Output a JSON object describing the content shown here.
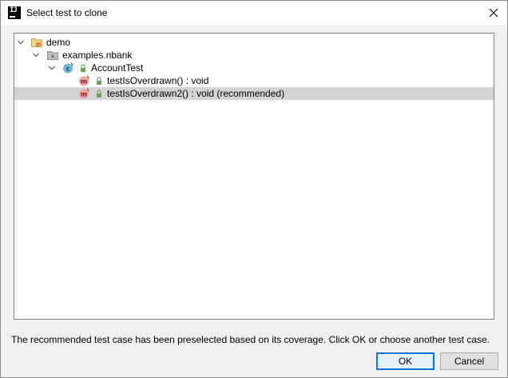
{
  "window": {
    "title": "Select test to clone",
    "app_icon_text": "IJ"
  },
  "tree": {
    "nodes": [
      {
        "label": "demo",
        "icon": "module-folder-icon",
        "expanded": true
      },
      {
        "label": "examples.nbank",
        "icon": "package-icon",
        "expanded": true
      },
      {
        "label": "AccountTest",
        "icon": "test-class-icon",
        "expanded": true
      },
      {
        "label": "testIsOverdrawn() : void",
        "icon": "test-method-icon",
        "selected": false
      },
      {
        "label": "testIsOverdrawn2() : void (recommended)",
        "icon": "test-method-icon",
        "selected": true
      }
    ]
  },
  "status_message": "The recommended test case has been preselected based on its coverage. Click OK or choose another test case.",
  "buttons": {
    "ok_label": "OK",
    "cancel_label": "Cancel"
  },
  "colors": {
    "selection": "#d4d4d4",
    "accent": "#0078d7",
    "method_badge": "#f28c8c",
    "class_badge": "#6fb7d6",
    "lock_green": "#6aa84f"
  }
}
